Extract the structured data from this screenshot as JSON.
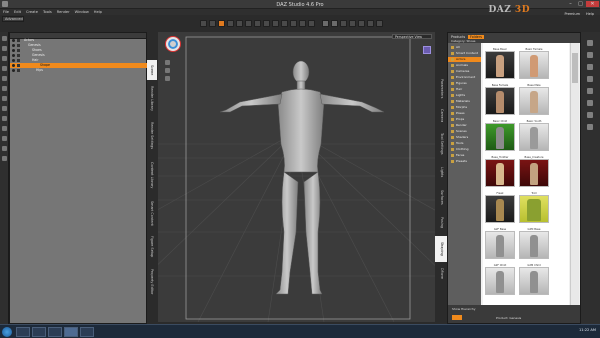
{
  "window": {
    "title": "DAZ Studio 4.6 Pro"
  },
  "window_controls": {
    "minimize": "–",
    "maximize": "□",
    "close": "✕"
  },
  "menu": [
    "File",
    "Edit",
    "Create",
    "Tools",
    "Render",
    "Window",
    "Help"
  ],
  "brand": {
    "daz": "DAZ",
    "three_d": " 3D"
  },
  "header_links": [
    "Premium",
    "Help"
  ],
  "workspace": {
    "label": "Advanced"
  },
  "scene_tree": [
    {
      "label": "Actors",
      "selected": false
    },
    {
      "label": "Genesis",
      "selected": false
    },
    {
      "label": "Shoes",
      "selected": false
    },
    {
      "label": "Genesis",
      "selected": false
    },
    {
      "label": "Hair",
      "selected": false
    },
    {
      "label": "Genesis 2",
      "selected": false
    },
    {
      "label": "Hips",
      "selected": false
    },
    {
      "label": "Shape",
      "selected": true
    }
  ],
  "left_tabs": [
    "Scene",
    "Render Library",
    "Render Settings",
    "Content Library",
    "Smart Content",
    "Figure Setup",
    "Property Editor"
  ],
  "viewport": {
    "camera": "Perspective View"
  },
  "right_tabs": [
    "Parameters",
    "Camera",
    "Tool Settings",
    "Lights",
    "Surfaces",
    "Posing",
    "Shaping",
    "DForm"
  ],
  "content_library": {
    "header_tabs": [
      "Products",
      "Folders"
    ],
    "search_label": "Category: Shoes",
    "tree": [
      {
        "label": "All",
        "selected": false
      },
      {
        "label": "Smart Content",
        "selected": false
      },
      {
        "label": "Actors",
        "selected": true
      },
      {
        "label": "Animals",
        "selected": false
      },
      {
        "label": "Cameras",
        "selected": false
      },
      {
        "label": "Environment",
        "selected": false
      },
      {
        "label": "Figures",
        "selected": false
      },
      {
        "label": "Hair",
        "selected": false
      },
      {
        "label": "Lights",
        "selected": false
      },
      {
        "label": "Materials",
        "selected": false
      },
      {
        "label": "Morphs",
        "selected": false
      },
      {
        "label": "Poses",
        "selected": false
      },
      {
        "label": "Props",
        "selected": false
      },
      {
        "label": "Render",
        "selected": false
      },
      {
        "label": "Scenes",
        "selected": false
      },
      {
        "label": "Shaders",
        "selected": false
      },
      {
        "label": "Tools",
        "selected": false
      },
      {
        "label": "Clothing",
        "selected": false
      },
      {
        "label": "Faces",
        "selected": false
      },
      {
        "label": "Presets",
        "selected": false
      }
    ],
    "thumbnails": [
      {
        "label": "Base Basic",
        "style": "dark"
      },
      {
        "label": "Basic Female",
        "style": "grey"
      },
      {
        "label": "Base Female",
        "style": "dark"
      },
      {
        "label": "Base Male",
        "style": "grey"
      },
      {
        "label": "Basic Child",
        "style": "green"
      },
      {
        "label": "Basic Youth",
        "style": "grey"
      },
      {
        "label": "Base_Toddler",
        "style": "red"
      },
      {
        "label": "Base_Creature",
        "style": "red"
      },
      {
        "label": "Freak",
        "style": "dark"
      },
      {
        "label": "Troll",
        "style": "green"
      },
      {
        "label": "G2F Base",
        "style": "grey"
      },
      {
        "label": "G2M Base",
        "style": "grey"
      },
      {
        "label": "G2F Child",
        "style": "grey"
      },
      {
        "label": "G2M Child",
        "style": "grey"
      }
    ],
    "footer_check": "Show Hierarchy",
    "status": "Product: Genesis"
  },
  "taskbar": {
    "clock": "11:22 AM"
  }
}
